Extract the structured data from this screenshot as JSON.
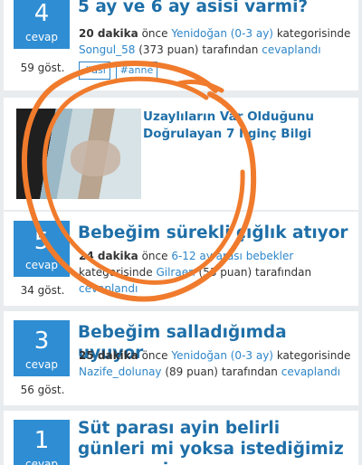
{
  "questions": [
    {
      "answer_count": "4",
      "answer_label": "cevap",
      "views": "59 göst.",
      "title": "5 ay ve 6 ay asisi varmi?",
      "time": "20 dakika",
      "time_suffix": "önce",
      "category": "Yenidoğan (0-3 ay)",
      "category_suffix": "kategorisinde",
      "user": "Songul_58",
      "points": "(373 puan)",
      "by_text": "tarafından",
      "status": "cevaplandı",
      "tags": [
        "#asi",
        "#anne"
      ]
    },
    {
      "answer_count": "5",
      "answer_label": "cevap",
      "views": "34 göst.",
      "title": "Bebeğim sürekli çığlık atıyor",
      "time": "24 dakika",
      "time_suffix": "önce",
      "category": "6-12 ay arası bebekler",
      "category_suffix": "kategorisinde",
      "user": "Gilraen",
      "points": "(53 puan)",
      "by_text": "tarafından",
      "status": "cevaplandı"
    },
    {
      "answer_count": "3",
      "answer_label": "cevap",
      "views": "56 göst.",
      "title": "Bebeğim salladığımda uyuyor",
      "time": "25 dakika",
      "time_suffix": "önce",
      "category": "Yenidoğan (0-3 ay)",
      "category_suffix": "kategorisinde",
      "user": "Nazife_dolunay",
      "points": "(89 puan)",
      "by_text": "tarafından",
      "status": "cevaplandı"
    },
    {
      "answer_count": "1",
      "answer_label": "cevap",
      "title": "Süt parası ayin belirli günleri mi yoksa istediğimiz zaman mi"
    }
  ],
  "ad": {
    "title": "Uzaylıların Var Olduğunu Doğrulayan 7 İlginç Bilgi"
  },
  "colors": {
    "accent": "#2f8dd3",
    "title": "#1f6fa8",
    "link": "#2e86c9",
    "annotation": "#f07b2c",
    "background": "#e9ecef"
  }
}
